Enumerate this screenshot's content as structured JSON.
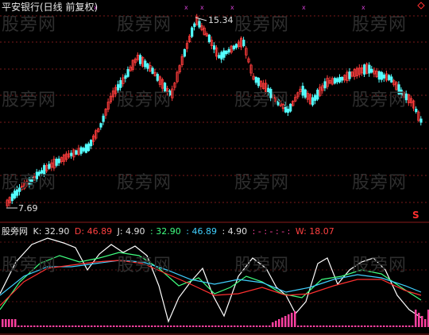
{
  "header": {
    "title": "平安银行(日线 前复权)"
  },
  "price": {
    "high_label": "15.34",
    "low_label": "7.69",
    "marker": "S",
    "marker_color": "#ff3030",
    "up_color": "#ff3c3c",
    "down_color": "#54ffff"
  },
  "indicator": {
    "name": "股旁网",
    "items": [
      {
        "key": "k_label",
        "text": "K: 32.90",
        "color": "#e0e0e0"
      },
      {
        "key": "d_label",
        "text": "D: 46.89",
        "color": "#ff4040"
      },
      {
        "key": "j_label",
        "text": "J: 4.90",
        "color": "#e0e0e0"
      },
      {
        "key": "v1",
        "text": ": 32.90",
        "color": "#40ff80"
      },
      {
        "key": "v2",
        "text": ": 46.89",
        "color": "#40d0ff"
      },
      {
        "key": "v3",
        "text": ": 4.90",
        "color": "#e0e0e0"
      },
      {
        "key": "v4",
        "text": ": - : - : - :",
        "color": "#ff40a0"
      },
      {
        "key": "w_label",
        "text": "W: 18.07",
        "color": "#ff4040"
      }
    ]
  },
  "watermark": "股旁网",
  "chart_data": {
    "type": "candlestick",
    "min": 7.69,
    "max": 15.34,
    "markers": [
      "x",
      "x",
      "x",
      "x",
      "x",
      "x"
    ],
    "series": [
      {
        "name": "K",
        "color": "#ffffff"
      },
      {
        "name": "D",
        "color": "#ff3030"
      },
      {
        "name": "J",
        "color": "#40ff80"
      },
      {
        "name": "W",
        "color": "#40d0ff"
      }
    ]
  }
}
